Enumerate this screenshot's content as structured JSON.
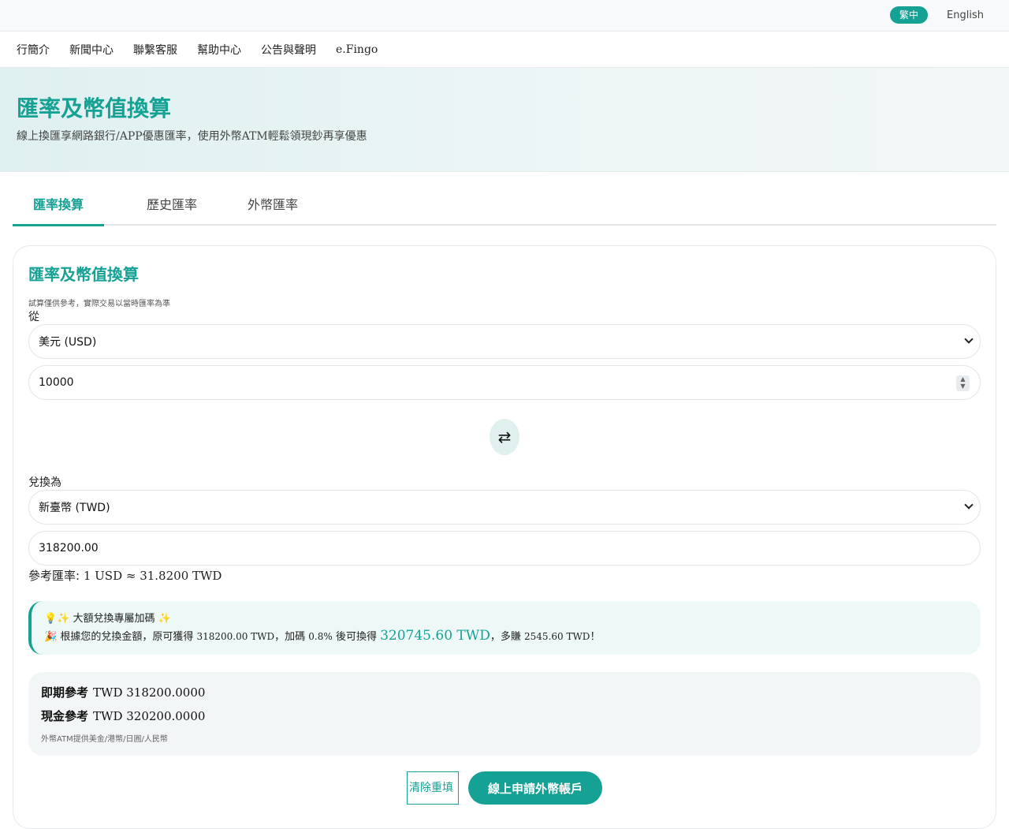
{
  "lang": {
    "current": "繁中",
    "english": "English"
  },
  "nav": {
    "items": [
      "行簡介",
      "新聞中心",
      "聯繫客服",
      "幫助中心",
      "公告與聲明",
      "e.Fingo"
    ]
  },
  "hero": {
    "title": "匯率及幣值換算",
    "subtitle": "線上換匯享網路銀行/APP優惠匯率，使用外幣ATM輕鬆領現鈔再享優惠"
  },
  "tabs": [
    "匯率換算",
    "歷史匯率",
    "外幣匯率"
  ],
  "converter": {
    "title": "匯率及幣值換算",
    "note": "試算僅供參考，實際交易以當時匯率為準",
    "from_label": "從",
    "from_currency": "美元 (USD)",
    "from_amount": "10000",
    "to_label": "兌換為",
    "to_currency": "新臺幣 (TWD)",
    "to_amount": "318200.00",
    "rate_label": "參考匯率:",
    "rate_value": "1 USD ≈ 31.8200 TWD",
    "swap_glyph": "⇄"
  },
  "promo": {
    "title": "💡✨ 大額兌換專屬加碼 ✨",
    "prefix": "🎉 根據您的兌換金額，原可獲得",
    "original": "318200.00 TWD",
    "mid": "，加碼",
    "bonus_pct": "0.8%",
    "mid2": "後可換得",
    "total": "320745.60 TWD",
    "mid3": "，多賺",
    "extra": "2545.60 TWD",
    "suffix": "！"
  },
  "reference": {
    "spot_label": "即期參考",
    "spot_value": "TWD 318200.0000",
    "cash_label": "現金參考",
    "cash_value": "TWD 320200.0000",
    "atm_note": "外幣ATM提供美金/港幣/日圓/人民幣"
  },
  "actions": {
    "clear": "清除重填",
    "apply": "線上申請外幣帳戶"
  },
  "colors": {
    "accent": "#16a195",
    "accent_light": "#dff0ef"
  }
}
